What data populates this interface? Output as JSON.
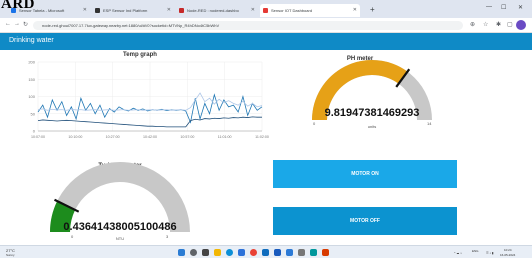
{
  "watermark": "ARD",
  "browser": {
    "tabs": [
      {
        "label": "Sensor Tabela - Microsoft",
        "color": "#1a73e8"
      },
      {
        "label": "ESP Sensor Ind Platform",
        "color": "#333333"
      },
      {
        "label": "Node-RED : nodered-dashbo",
        "color": "#c62828"
      },
      {
        "label": "Sensor IOT Dashboard",
        "color": "#e53935"
      }
    ],
    "new_tab": "+",
    "url": "node-red.ghoul7007.17.7lux-gateway.nearby.net:1880/ui/#!/0?socketid=MTVNp_R4hDNo4tC5bWhV",
    "window_controls": [
      "—",
      "☐",
      "✕"
    ]
  },
  "app": {
    "title": "Drinking water",
    "header_color": "#0f8ac6"
  },
  "temp_graph": {
    "title": "Temp graph",
    "chart_data": {
      "type": "line",
      "title": "Temp graph",
      "ylim": [
        0,
        200
      ],
      "y_ticks": [
        "200",
        "150",
        "100",
        "50",
        "0"
      ],
      "x_ticks": [
        "10:07:00",
        "10:10:00",
        "10:27:00",
        "10:42:00",
        "10:57:00",
        "11:01:00",
        "11:02:00"
      ],
      "series": [
        {
          "color": "#1f77b4",
          "values": [
            55,
            75,
            40,
            90,
            60,
            85,
            45,
            70,
            35,
            95,
            60,
            80,
            50,
            75,
            40,
            65,
            55,
            70,
            62,
            58,
            66,
            60,
            64,
            58,
            62,
            60,
            63,
            59,
            61,
            60,
            62,
            58,
            25,
            95,
            35,
            80,
            50,
            105,
            60,
            90,
            70,
            75,
            55,
            100,
            45,
            80,
            60,
            70
          ]
        },
        {
          "color": "#aec7e8",
          "values": [
            62,
            64,
            60,
            63,
            61,
            62,
            60,
            63,
            61,
            62,
            60,
            61,
            62,
            60,
            61,
            62,
            60,
            61,
            62,
            60,
            61,
            62,
            60,
            61,
            62,
            60,
            61,
            62,
            60,
            61,
            62,
            60,
            68,
            90,
            110,
            85,
            95,
            78,
            92,
            82,
            88,
            80,
            75,
            86,
            72,
            80,
            70,
            74
          ]
        },
        {
          "color": "#1f4e79",
          "values": [
            30,
            32,
            31,
            30,
            29,
            30,
            31,
            30,
            29,
            28,
            27,
            26,
            25,
            24,
            23,
            22,
            21,
            20,
            19,
            18,
            17,
            16,
            15,
            14,
            14,
            13,
            13,
            12,
            12,
            12,
            12,
            12,
            30,
            34,
            32,
            36,
            35,
            37,
            36,
            38,
            37,
            39,
            38,
            40,
            39,
            41,
            40,
            40
          ]
        }
      ]
    }
  },
  "ph_meter": {
    "title": "PH meter",
    "value": "9.81947381469293",
    "min": "0",
    "max": "14",
    "units": "units",
    "fraction": 0.7014,
    "color": "#e6a117"
  },
  "turbidity_meter": {
    "title": "Turbidity meter",
    "value": "0.43641438005100486",
    "min": "0",
    "max": "3",
    "units": "NTU",
    "fraction": 0.1455,
    "color": "#1d8c1d"
  },
  "buttons": {
    "motor_on": "MOTOR ON",
    "motor_off": "MOTOR OFF",
    "motor_on_color": "#1aa8e8",
    "motor_off_color": "#0c93d0"
  },
  "taskbar": {
    "weather_temp": "27°C",
    "weather_text": "Sunny",
    "lang": "ENG",
    "time": "10:24",
    "date": "16-05-2024",
    "apps": [
      "windows",
      "search",
      "task-view",
      "file-explorer",
      "edge",
      "store",
      "chrome",
      "mail",
      "word",
      "vscode",
      "settings",
      "arduino",
      "photos"
    ]
  }
}
